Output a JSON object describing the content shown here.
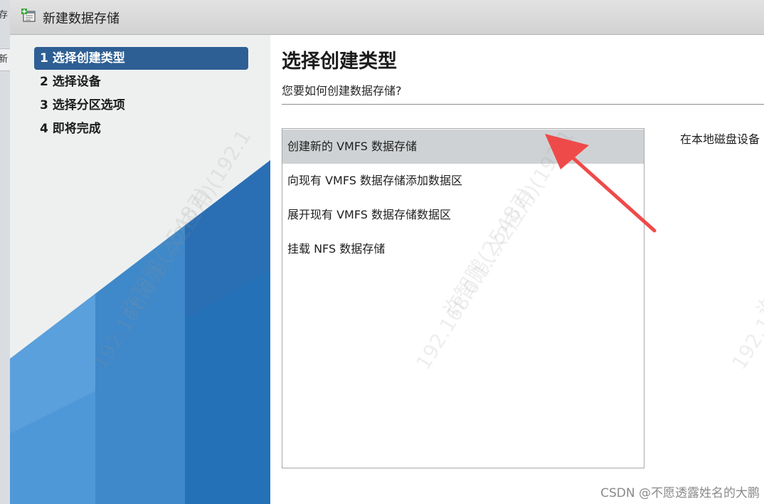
{
  "background_app": {
    "fragment_top": "存",
    "fragment_tab": "新"
  },
  "window": {
    "title": "新建数据存储"
  },
  "nav": {
    "steps": [
      {
        "label": "1 选择创建类型",
        "active": true
      },
      {
        "label": "2 选择设备",
        "active": false
      },
      {
        "label": "3 选择分区选项",
        "active": false
      },
      {
        "label": "4 即将完成",
        "active": false
      }
    ]
  },
  "main": {
    "title": "选择创建类型",
    "subtitle": "您要如何创建数据存储?",
    "options": [
      {
        "label": "创建新的 VMFS 数据存储",
        "selected": true
      },
      {
        "label": "向现有 VMFS 数据存储添加数据区",
        "selected": false
      },
      {
        "label": "展开现有 VMFS 数据存储数据区",
        "selected": false
      },
      {
        "label": "挂载 NFS 数据存储",
        "selected": false
      }
    ],
    "description": "在本地磁盘设备"
  },
  "watermark": {
    "line1": "许智鹏(25487)",
    "line2": "192.168.0.1...X2应用)(192.1"
  },
  "credit": "CSDN @不愿透露姓名的大鹏",
  "colors": {
    "active_step_bg": "#2e5f94",
    "selected_option_bg": "#cfd2d4",
    "annotation_arrow": "#ef4a4a",
    "nav_art_blue": "#2a7fc8"
  }
}
